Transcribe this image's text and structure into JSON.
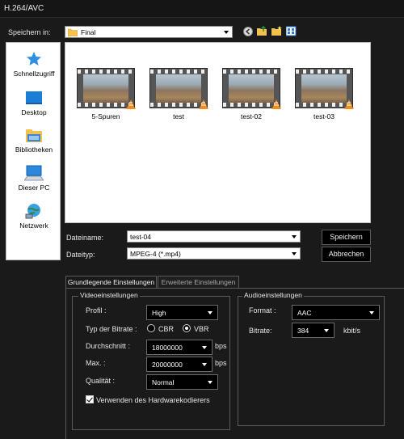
{
  "window": {
    "title": "H.264/AVC"
  },
  "location": {
    "label": "Speichern in:",
    "value": "Final"
  },
  "toolbar_icons": [
    "back-icon",
    "up-folder-icon",
    "new-folder-icon",
    "view-menu-icon"
  ],
  "sidebar": {
    "items": [
      {
        "label": "Schnellzugriff",
        "icon": "star-icon"
      },
      {
        "label": "Desktop",
        "icon": "desktop-icon"
      },
      {
        "label": "Bibliotheken",
        "icon": "library-icon"
      },
      {
        "label": "Dieser PC",
        "icon": "computer-icon"
      },
      {
        "label": "Netzwerk",
        "icon": "network-icon"
      }
    ]
  },
  "files": [
    {
      "name": "5-Spuren"
    },
    {
      "name": "test"
    },
    {
      "name": "test-02"
    },
    {
      "name": "test-03"
    }
  ],
  "filename": {
    "label": "Dateiname:",
    "value": "test-04"
  },
  "filetype": {
    "label": "Dateityp:",
    "value": "MPEG-4 (*.mp4)"
  },
  "buttons": {
    "save": "Speichern",
    "cancel": "Abbrechen"
  },
  "tabs": [
    {
      "label": "Grundlegende Einstellungen",
      "active": true
    },
    {
      "label": "Erweiterte Einstellungen",
      "active": false
    }
  ],
  "video": {
    "title": "Videoeinstellungen",
    "profile": {
      "label": "Profil :",
      "value": "High"
    },
    "bitrate_type": {
      "label": "Typ der Bitrate :",
      "cbr": "CBR",
      "vbr": "VBR",
      "selected": "VBR"
    },
    "average": {
      "label": "Durchschnitt :",
      "value": "18000000",
      "unit": "bps"
    },
    "max": {
      "label": "Max. :",
      "value": "20000000",
      "unit": "bps"
    },
    "quality": {
      "label": "Qualität :",
      "value": "Normal"
    },
    "hardware": {
      "label": "Verwenden des Hardwarekodierers",
      "checked": true
    }
  },
  "audio": {
    "title": "Audioeinstellungen",
    "format": {
      "label": "Format :",
      "value": "AAC"
    },
    "bitrate": {
      "label": "Bitrate:",
      "value": "384",
      "unit": "kbit/s"
    }
  }
}
